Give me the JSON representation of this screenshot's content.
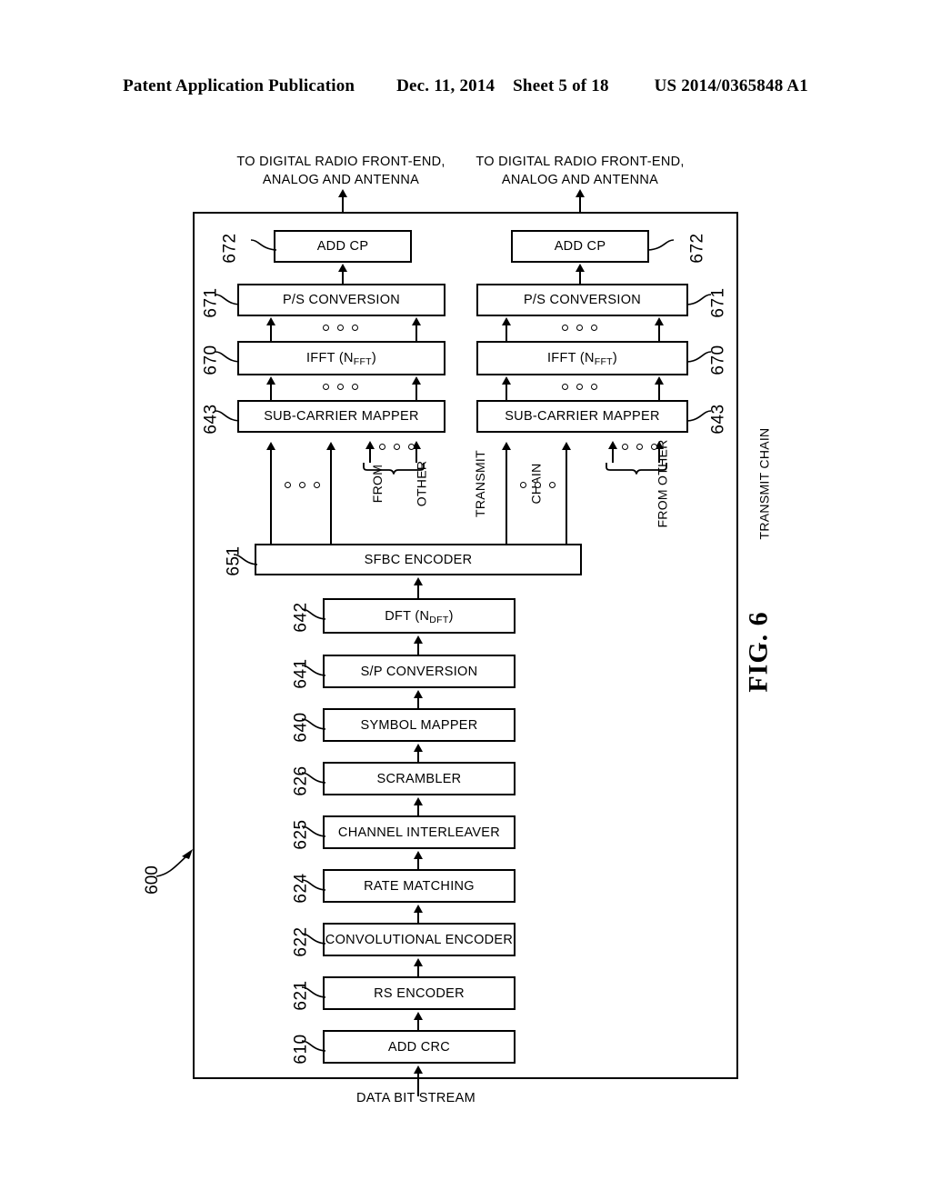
{
  "header": {
    "publication": "Patent Application Publication",
    "date": "Dec. 11, 2014",
    "sheet": "Sheet 5 of 18",
    "number": "US 2014/0365848 A1"
  },
  "figure": {
    "label": "FIG. 6",
    "ref_main": "600"
  },
  "callouts": {
    "top_left_line1": "TO DIGITAL RADIO FRONT-END,",
    "top_left_line2": "ANALOG AND ANTENNA",
    "top_right_line1": "TO DIGITAL RADIO FRONT-END,",
    "top_right_line2": "ANALOG AND ANTENNA",
    "bottom": "DATA BIT STREAM",
    "from_other_left": [
      "FROM",
      "OTHER",
      "TRANSMIT",
      "CHAIN"
    ],
    "from_other_right": [
      "FROM OTHER",
      "TRANSMIT CHAIN"
    ]
  },
  "chain_left": [
    {
      "ref": "672",
      "label": "ADD CP"
    },
    {
      "ref": "671",
      "label": "P/S CONVERSION"
    },
    {
      "ref": "670",
      "label": "IFFT (N",
      "sub": "FFT",
      "label_tail": ")"
    },
    {
      "ref": "643",
      "label": "SUB-CARRIER MAPPER"
    }
  ],
  "chain_right": [
    {
      "ref": "672",
      "label": "ADD CP"
    },
    {
      "ref": "671",
      "label": "P/S CONVERSION"
    },
    {
      "ref": "670",
      "label": "IFFT (N",
      "sub": "FFT",
      "label_tail": ")"
    },
    {
      "ref": "643",
      "label": "SUB-CARRIER MAPPER"
    }
  ],
  "chain_main": [
    {
      "ref": "651",
      "label": "SFBC ENCODER"
    },
    {
      "ref": "642",
      "label": "DFT (N",
      "sub": "DFT",
      "label_tail": ")"
    },
    {
      "ref": "641",
      "label": "S/P CONVERSION"
    },
    {
      "ref": "640",
      "label": "SYMBOL MAPPER"
    },
    {
      "ref": "626",
      "label": "SCRAMBLER"
    },
    {
      "ref": "625",
      "label": "CHANNEL INTERLEAVER"
    },
    {
      "ref": "624",
      "label": "RATE MATCHING"
    },
    {
      "ref": "622",
      "label": "CONVOLUTIONAL ENCODER"
    },
    {
      "ref": "621",
      "label": "RS ENCODER"
    },
    {
      "ref": "610",
      "label": "ADD CRC"
    }
  ],
  "colors": {
    "ink": "#000000",
    "paper": "#ffffff"
  }
}
